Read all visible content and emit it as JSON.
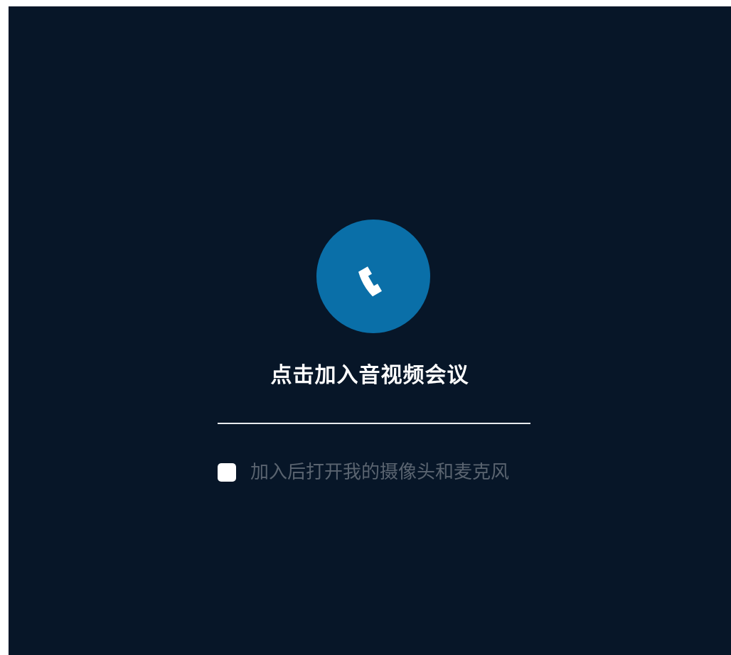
{
  "join_panel": {
    "call_button_icon": "phone-icon",
    "title": "点击加入音视频会议",
    "option_label": "加入后打开我的摄像头和麦克风",
    "option_checked": false
  },
  "colors": {
    "background": "#071628",
    "call_button": "#0a6fa8",
    "title_text": "#ffffff",
    "option_text": "#5a6470",
    "checkbox": "#ffffff",
    "divider": "#e8ebee"
  }
}
